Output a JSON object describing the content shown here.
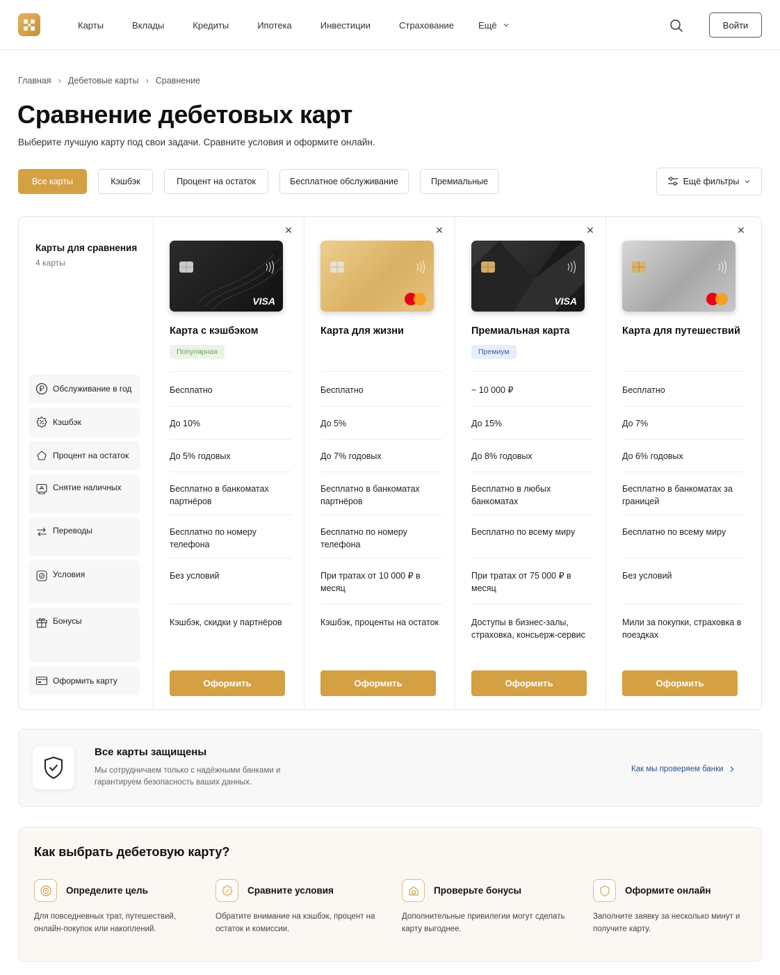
{
  "header": {
    "nav": [
      "Карты",
      "Вклады",
      "Кредиты",
      "Ипотека",
      "Инвестиции",
      "Страхование",
      "Ещё"
    ],
    "login": "Войти"
  },
  "breadcrumbs": [
    "Главная",
    "Дебетовые карты",
    "Сравнение"
  ],
  "title": "Сравнение дебетовых карт",
  "subtitle": "Выберите лучшую карту под свои задачи. Сравните условия и оформите онлайн.",
  "filters": {
    "chips": [
      "Все карты",
      "Кэшбэк",
      "Процент на остаток",
      "Бесплатное обслуживание",
      "Премиальные"
    ],
    "active_index": 0,
    "more": "Ещё фильтры"
  },
  "compare": {
    "title": "Карты для сравнения",
    "count": "4 карты",
    "features": [
      {
        "label": "Обслуживание в год",
        "icon": "ruble-icon"
      },
      {
        "label": "Кэшбэк",
        "icon": "cashback-icon"
      },
      {
        "label": "Процент на остаток",
        "icon": "percent-icon"
      },
      {
        "label": "Снятие наличных",
        "icon": "atm-icon"
      },
      {
        "label": "Переводы",
        "icon": "transfer-icon"
      },
      {
        "label": "Условия",
        "icon": "conditions-icon"
      },
      {
        "label": "Бонусы",
        "icon": "gift-icon"
      },
      {
        "label": "Оформить карту",
        "icon": "card-icon"
      }
    ],
    "cards": [
      {
        "name": "Карта с кэшбэком",
        "badge": "Популярная",
        "badge_style": "green",
        "style": "black",
        "network": "VISA",
        "values": [
          "Бесплатно",
          "До 10%",
          "До 5% годовых",
          "Бесплатно в банкоматах партнёров",
          "Бесплатно по номеру телефона",
          "Без условий",
          "Кэшбэк, скидки у партнёров"
        ],
        "button": "Оформить"
      },
      {
        "name": "Карта для жизни",
        "badge": "",
        "badge_style": "",
        "style": "gold",
        "network": "mastercard",
        "values": [
          "Бесплатно",
          "До 5%",
          "До 7% годовых",
          "Бесплатно в банкоматах партнёров",
          "Бесплатно по номеру телефона",
          "При тратах от 10 000 ₽ в месяц",
          "Кэшбэк, проценты на остаток"
        ],
        "button": "Оформить"
      },
      {
        "name": "Премиальная карта",
        "badge": "Премиум",
        "badge_style": "blue",
        "style": "dark",
        "network": "VISA",
        "values": [
          "~ 10 000 ₽",
          "До 15%",
          "До 8% годовых",
          "Бесплатно в любых банкоматах",
          "Бесплатно по всему миру",
          "При тратах от 75 000 ₽ в месяц",
          "Доступы в бизнес-залы, страховка, консьерж-сервис"
        ],
        "button": "Оформить"
      },
      {
        "name": "Карта для путешествий",
        "badge": "",
        "badge_style": "",
        "style": "silver",
        "network": "mastercard",
        "values": [
          "Бесплатно",
          "До 7%",
          "До 6% годовых",
          "Бесплатно в банкоматах за границей",
          "Бесплатно по всему миру",
          "Без условий",
          "Мили за покупки, страховка в поездках"
        ],
        "button": "Оформить"
      }
    ]
  },
  "secure": {
    "title": "Все карты защищены",
    "text": "Мы сотрудничаем только с надёжными банками и гарантируем безопасность ваших данных.",
    "link": "Как мы проверяем банки"
  },
  "howto": {
    "title": "Как выбрать дебетовую карту?",
    "steps": [
      {
        "title": "Определите цель",
        "text": "Для повседневных трат, путешествий, онлайн-покупок или накоплений.",
        "icon": "target-icon"
      },
      {
        "title": "Сравните условия",
        "text": "Обратите внимание на кэшбэк, процент на остаток и комиссии.",
        "icon": "compare-icon"
      },
      {
        "title": "Проверьте бонусы",
        "text": "Дополнительные привилегии могут сделать карту выгоднее.",
        "icon": "bonus-icon"
      },
      {
        "title": "Оформите онлайн",
        "text": "Заполните заявку за несколько минут и получите карту.",
        "icon": "online-icon"
      }
    ]
  },
  "colors": {
    "accent": "#d4a044",
    "badge_green_bg": "#e9f4e7",
    "badge_blue_bg": "#e6eefb",
    "link": "#2d4f8a"
  }
}
